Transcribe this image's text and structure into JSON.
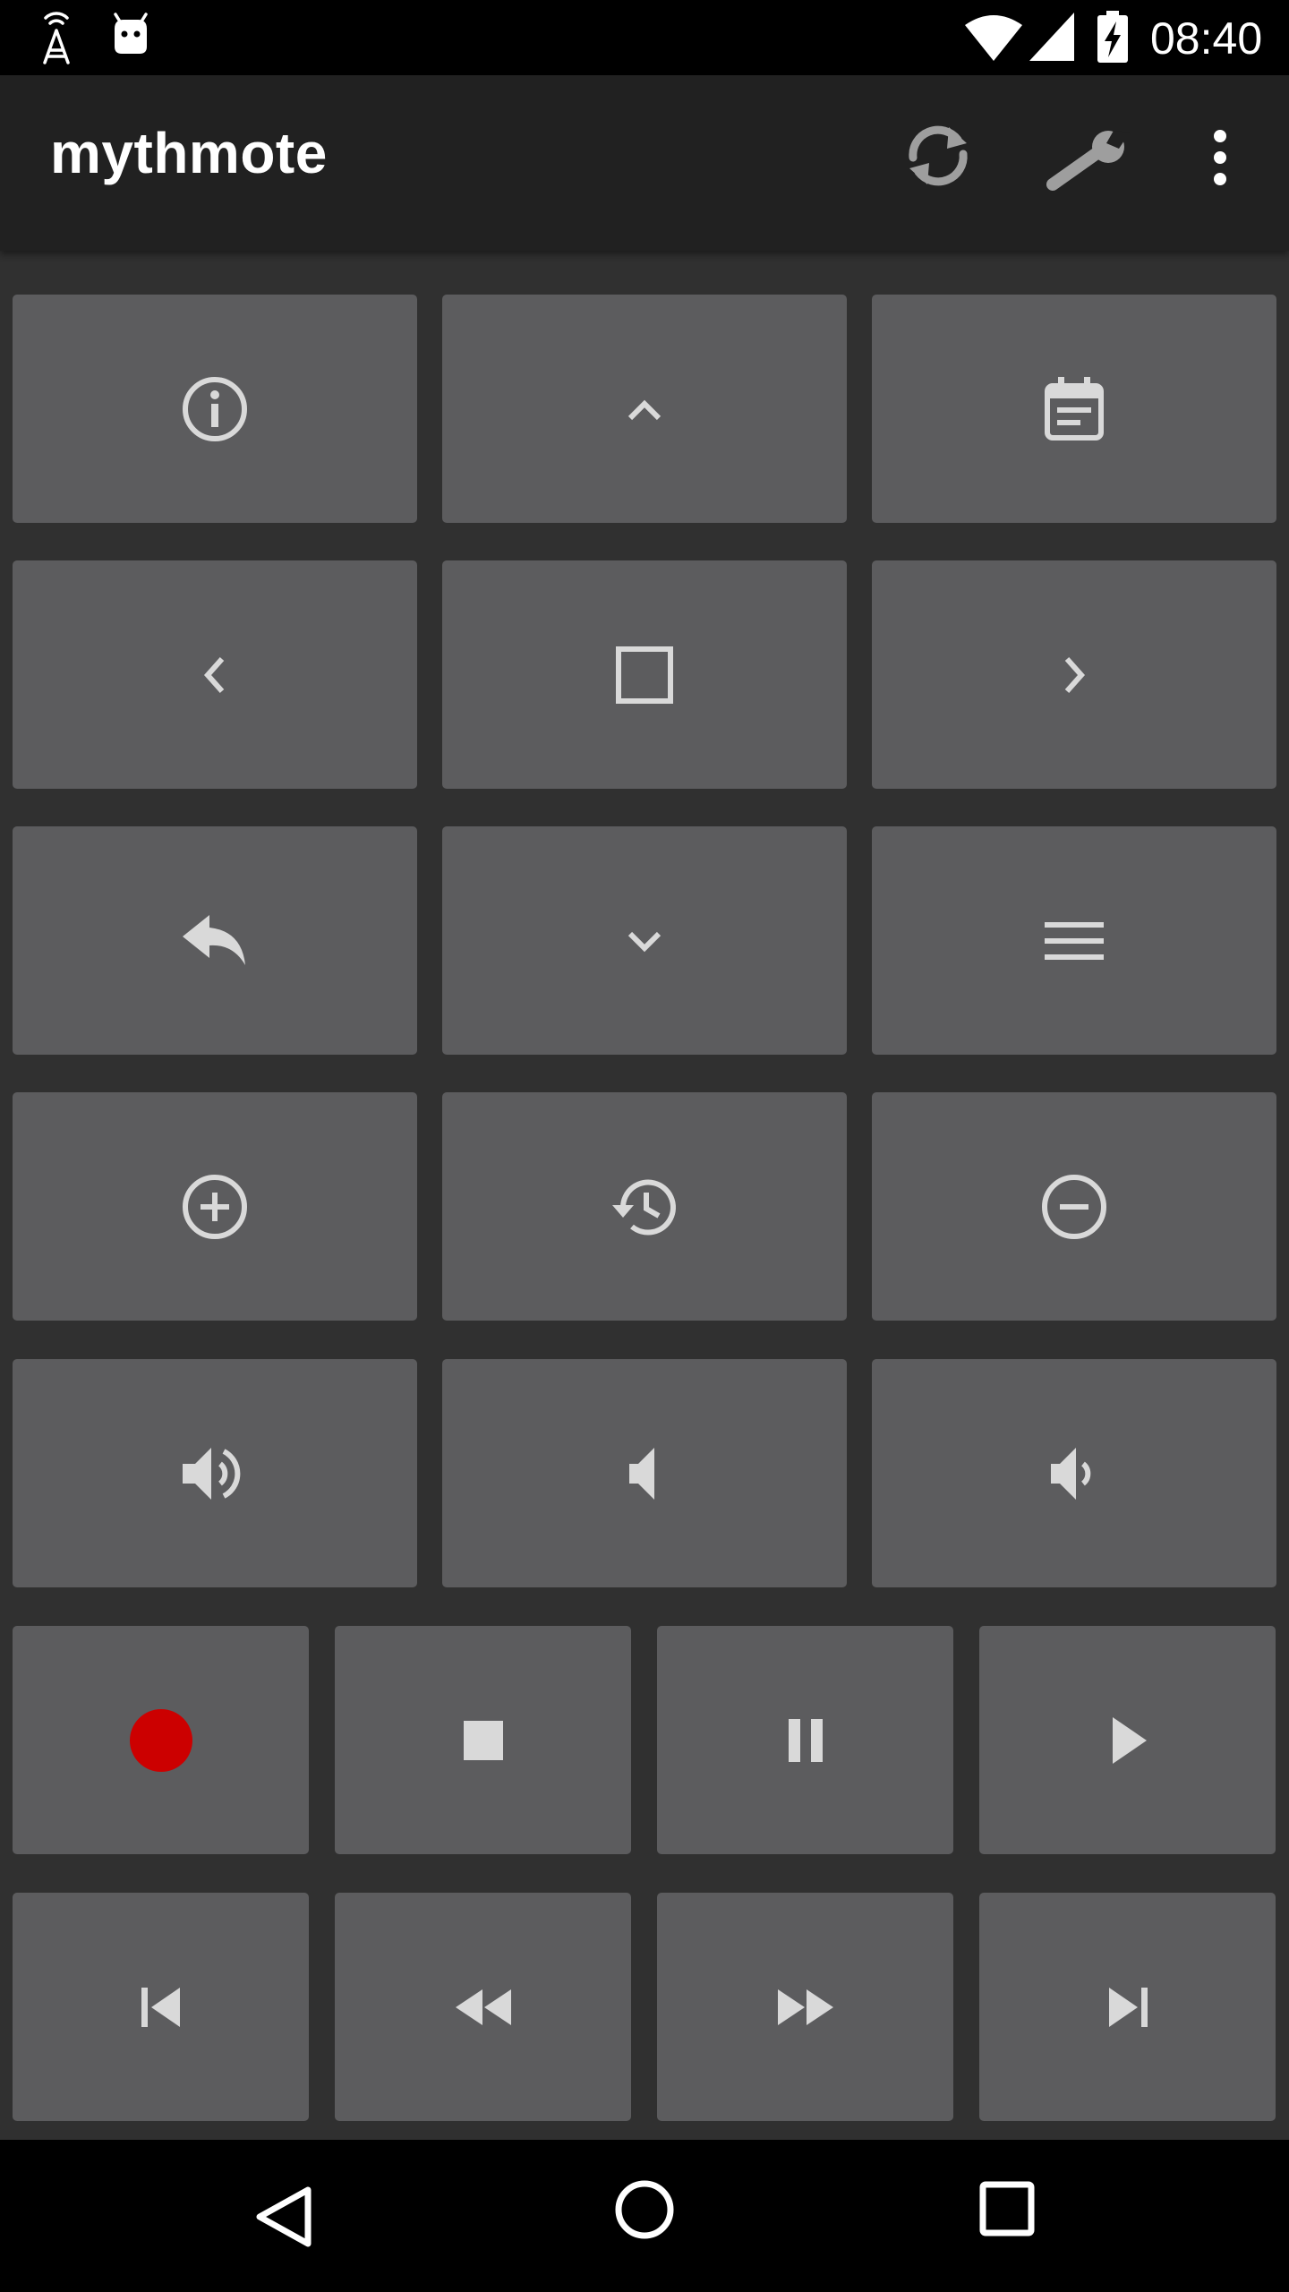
{
  "status_bar": {
    "time": "08:40",
    "icons": [
      "signal-tower-icon",
      "android-debug-icon",
      "wifi-icon",
      "cell-signal-icon",
      "battery-charging-icon"
    ]
  },
  "app_bar": {
    "title": "mythmote",
    "actions": [
      "refresh-icon",
      "wrench-icon",
      "more-vert-icon"
    ]
  },
  "remote": {
    "rows": [
      [
        "info-icon",
        "arrow-up-icon",
        "guide-calendar-icon"
      ],
      [
        "arrow-left-icon",
        "select-square-icon",
        "arrow-right-icon"
      ],
      [
        "back-reply-icon",
        "arrow-down-icon",
        "menu-icon"
      ],
      [
        "channel-up-plus-icon",
        "recent-history-icon",
        "channel-down-minus-icon"
      ],
      [
        "volume-up-icon",
        "mute-icon",
        "volume-down-icon"
      ],
      [
        "record-icon",
        "stop-icon",
        "pause-icon",
        "play-icon"
      ],
      [
        "skip-previous-icon",
        "rewind-icon",
        "fast-forward-icon",
        "skip-next-icon"
      ]
    ]
  },
  "colors": {
    "background": "#303030",
    "app_bar": "#212121",
    "button": "#5c5c5e",
    "icon": "#d9d9d9",
    "record": "#cc0000"
  },
  "nav_bar": [
    "back-icon",
    "home-icon",
    "recents-icon"
  ]
}
